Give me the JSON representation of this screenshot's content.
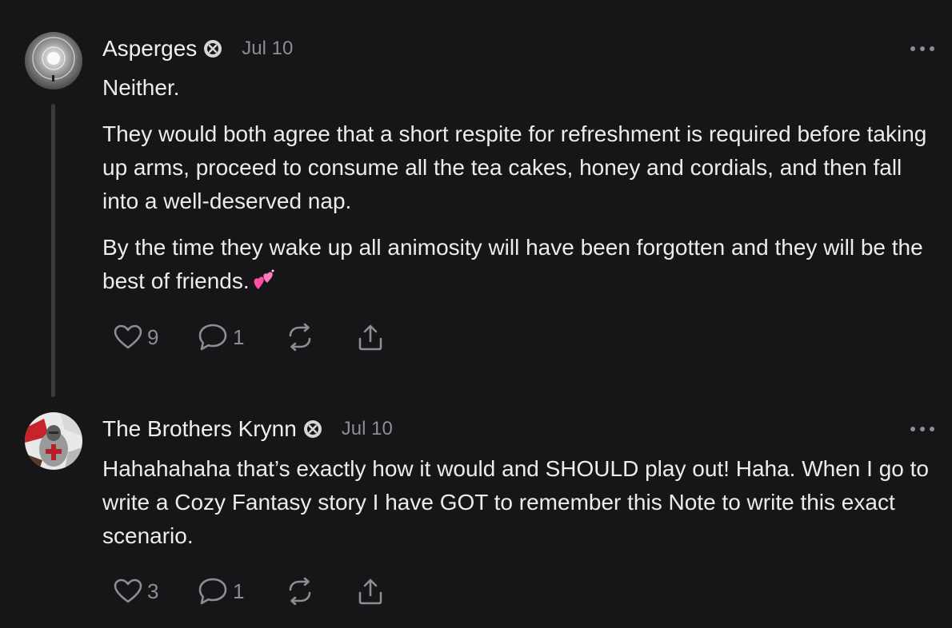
{
  "comments": [
    {
      "author": "Asperges",
      "date": "Jul 10",
      "paragraphs": [
        "Neither.",
        "They would both agree that a short respite for refreshment is required before taking up arms, proceed to consume all the tea cakes, honey and cordials, and then fall into a well-deserved nap.",
        "By the time they wake up all animosity will have been forgotten and they will be the best of friends."
      ],
      "likes": "9",
      "replies": "1"
    },
    {
      "author": "The Brothers Krynn",
      "date": "Jul 10",
      "paragraphs": [
        "Hahahahaha that’s exactly how it would and SHOULD play out! Haha. When I go to write a Cozy Fantasy story I have GOT to remember this Note to write this exact scenario."
      ],
      "likes": "3",
      "replies": "1"
    }
  ],
  "icons": {
    "like": "heart-icon",
    "reply": "comment-bubble-icon",
    "restack": "restack-icon",
    "share": "share-icon",
    "more": "more-dots-icon",
    "badge": "subscriber-badge-icon",
    "emoji": "two-hearts-emoji"
  },
  "colors": {
    "background": "#161618",
    "text": "#ececec",
    "muted": "#8d8d92",
    "thread_line": "#3a3a3d",
    "emoji": "#ff4fa3"
  }
}
